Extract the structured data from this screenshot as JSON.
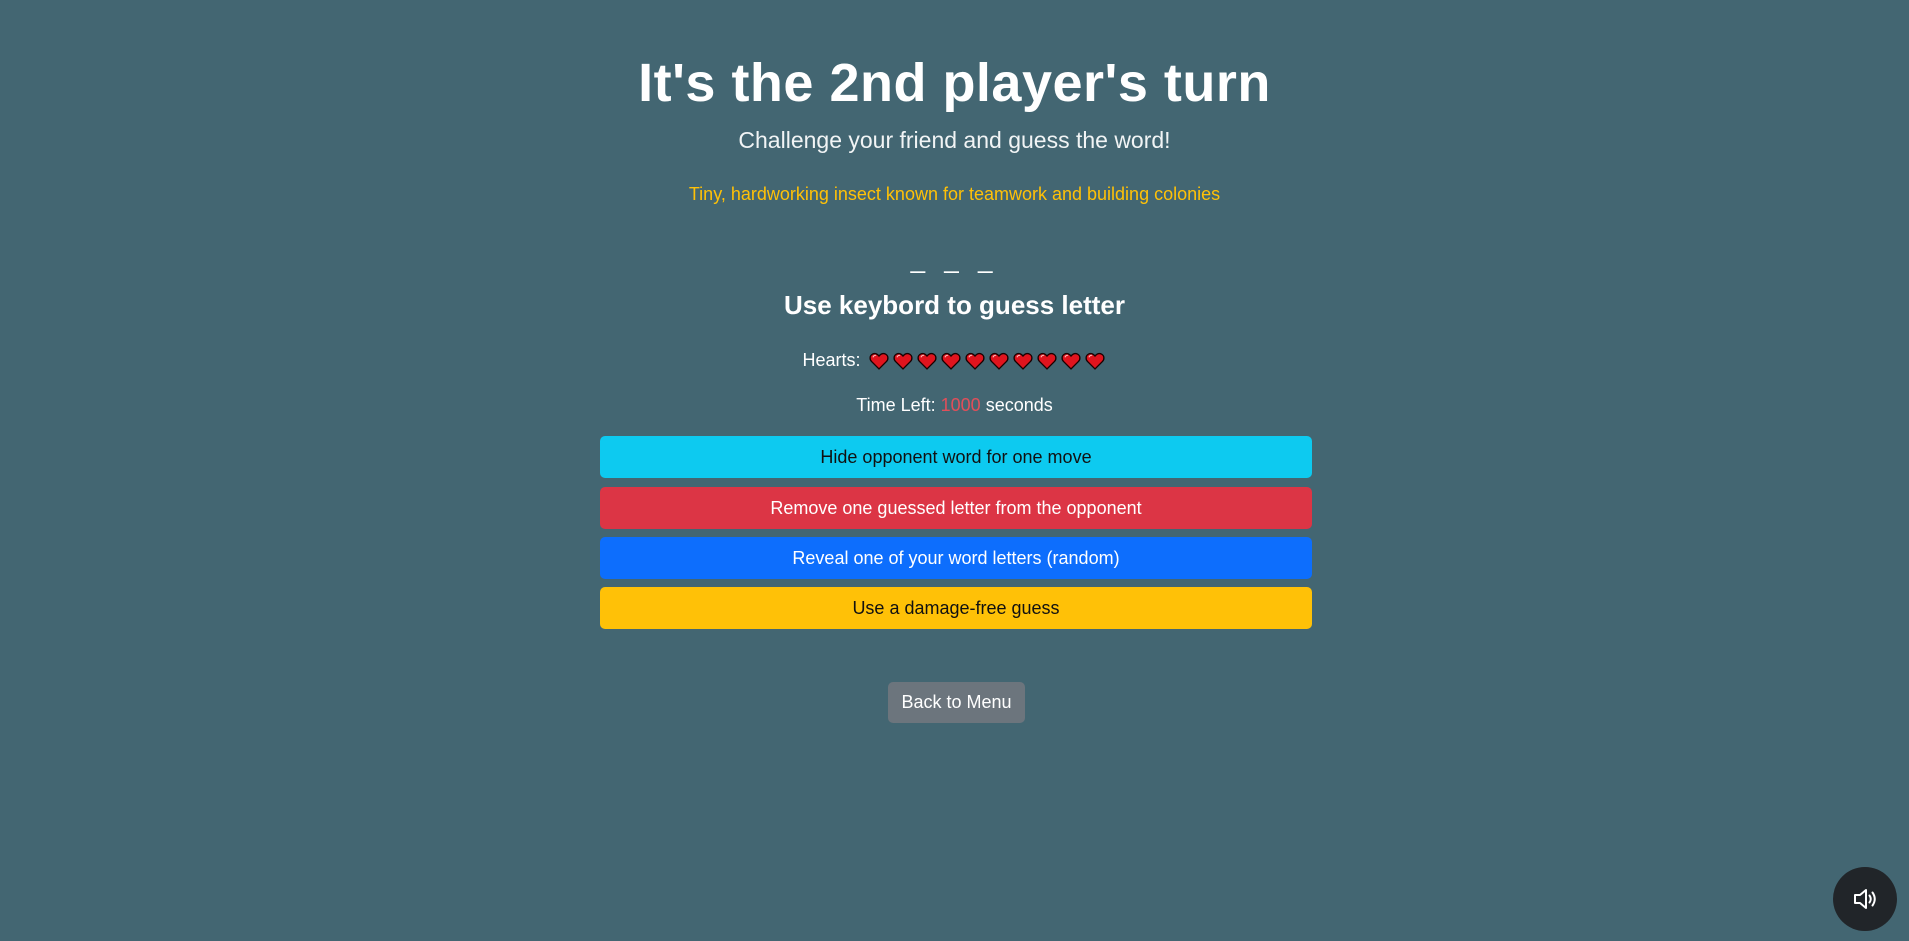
{
  "header": {
    "title": "It's the 2nd player's turn",
    "subtitle": "Challenge your friend and guess the word!"
  },
  "hint": "Tiny, hardworking insect known for teamwork and building colonies",
  "word_display": "_ _ _",
  "instruction": "Use keybord to guess letter",
  "hearts": {
    "label": "Hearts:",
    "count": 10,
    "color": "#e0141e"
  },
  "timer": {
    "label": "Time Left:",
    "value": "1000",
    "unit": "seconds"
  },
  "powerups": {
    "hide_label": "Hide opponent word for one move",
    "remove_label": "Remove one guessed letter from the opponent",
    "reveal_label": "Reveal one of your word letters (random)",
    "damage_free_label": "Use a damage-free guess"
  },
  "back_label": "Back to Menu",
  "sound": {
    "icon": "speaker-icon"
  },
  "colors": {
    "background": "#436672",
    "hint": "#ffc107",
    "hide_button": "#0dcaf0",
    "remove_button": "#dc3545",
    "reveal_button": "#0d6efd",
    "damage_free_button": "#ffc107",
    "back_button": "#6c757d",
    "time_value": "#e14f5a"
  }
}
